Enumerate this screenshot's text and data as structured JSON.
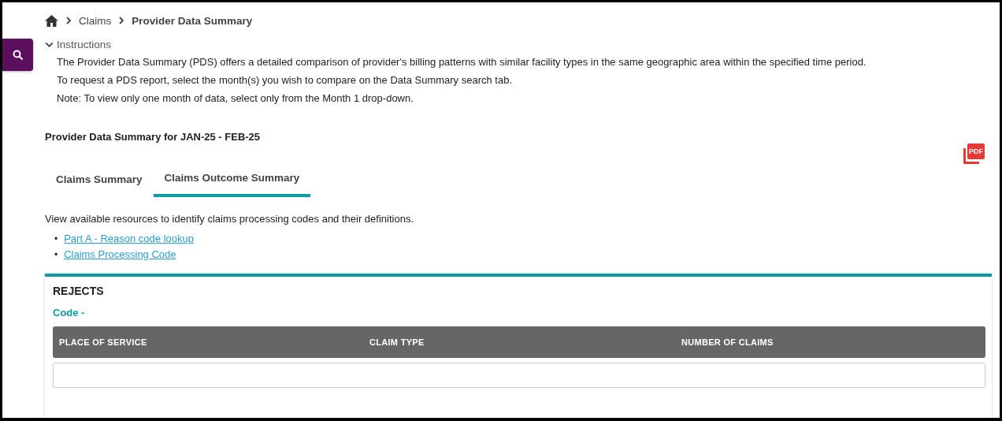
{
  "breadcrumb": [
    {
      "label": "Claims",
      "current": false
    },
    {
      "label": "Provider Data Summary",
      "current": true
    }
  ],
  "instructions": {
    "title": "Instructions",
    "expanded": true,
    "paragraphs": [
      "The Provider Data Summary (PDS) offers a detailed comparison of provider's billing patterns with similar facility types in the same geographic area within the specified time period.",
      "To request a PDS report, select the month(s) you wish to compare on the Data Summary search tab.",
      "Note: To view only one month of data, select only from the Month 1 drop-down."
    ]
  },
  "report_title": "Provider Data Summary for JAN-25 - FEB-25",
  "pdf_label": "PDF",
  "tabs": [
    {
      "label": "Claims Summary",
      "selected": false
    },
    {
      "label": "Claims Outcome Summary",
      "selected": true
    }
  ],
  "resources_text": "View available resources to identify claims processing codes and their definitions.",
  "links": [
    {
      "bullet": "•",
      "label": "Part A - Reason code lookup"
    },
    {
      "bullet": "•",
      "label": "Claims Processing Code"
    }
  ],
  "section": {
    "title": "REJECTS",
    "code_label": "Code -",
    "columns": [
      "PLACE OF SERVICE",
      "CLAIM TYPE",
      "NUMBER OF CLAIMS"
    ]
  }
}
